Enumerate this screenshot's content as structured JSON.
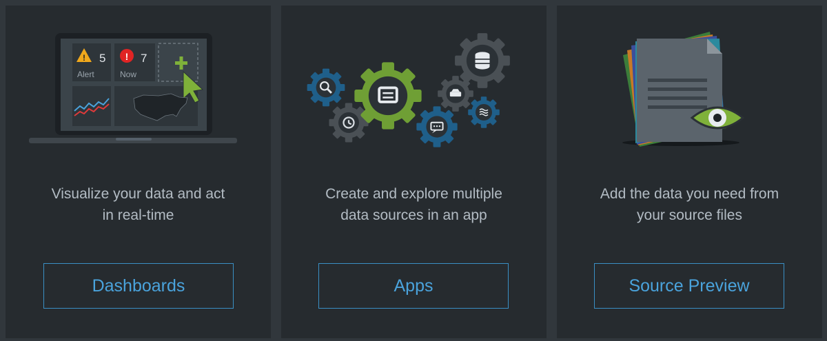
{
  "cards": [
    {
      "illustration": "laptop-dashboard-illustration",
      "alert_count": "5",
      "alert_label": "Alert",
      "now_count": "7",
      "now_label": "Now",
      "description": "Visualize your data and act\nin real-time",
      "button_label": "Dashboards"
    },
    {
      "illustration": "gears-illustration",
      "description": "Create and explore multiple\ndata sources in an app",
      "button_label": "Apps"
    },
    {
      "illustration": "documents-eye-illustration",
      "description": "Add the data you need from\nyour source files",
      "button_label": "Source Preview"
    }
  ],
  "colors": {
    "background": "#31373c",
    "card": "#262b2f",
    "accent_blue": "#3a90c5",
    "accent_green": "#7fb13a",
    "text": "#b3bcc4"
  }
}
